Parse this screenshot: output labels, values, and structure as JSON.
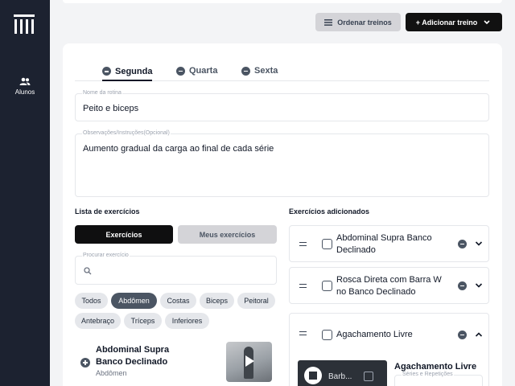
{
  "sidebar": {
    "nav": [
      {
        "label": "Alunos",
        "icon": "users-icon"
      }
    ]
  },
  "toolbar": {
    "order_label": "Ordenar treinos",
    "order_icon": "list-icon",
    "add_label": "+ Adicionar treino",
    "add_icon": "chevron-down-icon"
  },
  "tabs": [
    {
      "label": "Segunda",
      "active": true
    },
    {
      "label": "Quarta",
      "active": false
    },
    {
      "label": "Sexta",
      "active": false
    }
  ],
  "routine": {
    "name_label": "Nome da rotina",
    "name_value": "Peito e biceps",
    "notes_label": "Observações/Instruções(Opcional)",
    "notes_value": "Aumento gradual da carga ao final de cada série"
  },
  "exercise_list": {
    "title": "Lista de exercícios",
    "segments": [
      "Exercícios",
      "Meus exercícios"
    ],
    "search_label": "Procurar exercício",
    "search_value": "",
    "filters": [
      {
        "label": "Todos",
        "active": false
      },
      {
        "label": "Abdômen",
        "active": true
      },
      {
        "label": "Costas",
        "active": false
      },
      {
        "label": "Biceps",
        "active": false
      },
      {
        "label": "Peitoral",
        "active": false
      },
      {
        "label": "Antebraço",
        "active": false
      },
      {
        "label": "Tríceps",
        "active": false
      },
      {
        "label": "Inferiores",
        "active": false
      }
    ],
    "items": [
      {
        "name": "Abdominal Supra Banco Declinado",
        "category": "Abdômen"
      }
    ]
  },
  "added_exercises": {
    "title": "Exercícios adicionados",
    "items": [
      {
        "name": "Abdominal Supra Banco Declinado",
        "expanded": false
      },
      {
        "name": "Rosca Direta com Barra W no Banco Declinado",
        "expanded": false
      },
      {
        "name": "Agachamento Livre",
        "expanded": true
      }
    ],
    "detail": {
      "video_text": "Barb...",
      "name": "Agachamento Livre",
      "sets_label": "Séries e Repetições"
    }
  }
}
